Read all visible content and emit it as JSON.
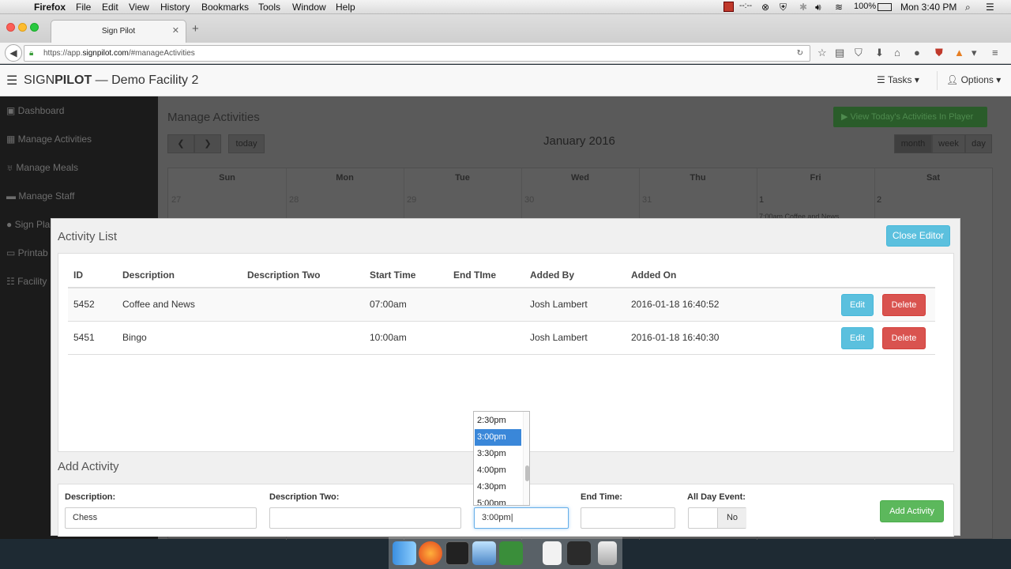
{
  "menubar": {
    "app": "Firefox",
    "items": [
      "File",
      "Edit",
      "View",
      "History",
      "Bookmarks",
      "Tools",
      "Window",
      "Help"
    ],
    "status_time_dots": "--:--",
    "battery": "100%",
    "clock": "Mon 3:40 PM"
  },
  "browser": {
    "tab_title": "Sign Pilot",
    "url_prefix": "https://app.",
    "url_domain": "signpilot.com",
    "url_path": "/#manageActivities"
  },
  "header": {
    "brand_light": "SIGN",
    "brand_bold": "PILOT",
    "facility": " —  Demo Facility 2",
    "tasks": "Tasks",
    "options": "Options"
  },
  "sidebar": {
    "items": [
      "Dashboard",
      "Manage Activities",
      "Manage Meals",
      "Manage Staff",
      "Sign Pla",
      "Printab",
      "Facility"
    ]
  },
  "calendar": {
    "title": "Manage Activities",
    "month": "January 2016",
    "today": "today",
    "views": [
      "month",
      "week",
      "day"
    ],
    "player_button": "View Today's Activities In Player",
    "days": [
      "Sun",
      "Mon",
      "Tue",
      "Wed",
      "Thu",
      "Fri",
      "Sat"
    ],
    "first_row_dates": [
      "27",
      "28",
      "29",
      "30",
      "31",
      "1",
      "2"
    ],
    "event": "7:00am Coffee and News"
  },
  "modal": {
    "title": "Activity List",
    "close_label": "Close Editor",
    "columns": [
      "ID",
      "Description",
      "Description Two",
      "Start Time",
      "End TIme",
      "Added By",
      "Added On"
    ],
    "rows": [
      {
        "id": "5452",
        "description": "Coffee and News",
        "description_two": "",
        "start": "07:00am",
        "end": "",
        "added_by": "Josh Lambert",
        "added_on": "2016-01-18 16:40:52"
      },
      {
        "id": "5451",
        "description": "Bingo",
        "description_two": "",
        "start": "10:00am",
        "end": "",
        "added_by": "Josh Lambert",
        "added_on": "2016-01-18 16:40:30"
      }
    ],
    "edit_label": "Edit",
    "delete_label": "Delete"
  },
  "add_activity": {
    "title": "Add Activity",
    "description_label": "Description:",
    "description_value": "Chess",
    "description_two_label": "Description Two:",
    "description_two_value": "",
    "start_value": "3:00pm",
    "end_label": "End Time:",
    "end_value": "",
    "all_day_label": "All Day Event:",
    "all_day_value": "No",
    "add_label": "Add Activity"
  },
  "time_dropdown": {
    "options": [
      "2:30pm",
      "3:00pm",
      "3:30pm",
      "4:00pm",
      "4:30pm",
      "5:00pm"
    ],
    "selected": "3:00pm"
  }
}
